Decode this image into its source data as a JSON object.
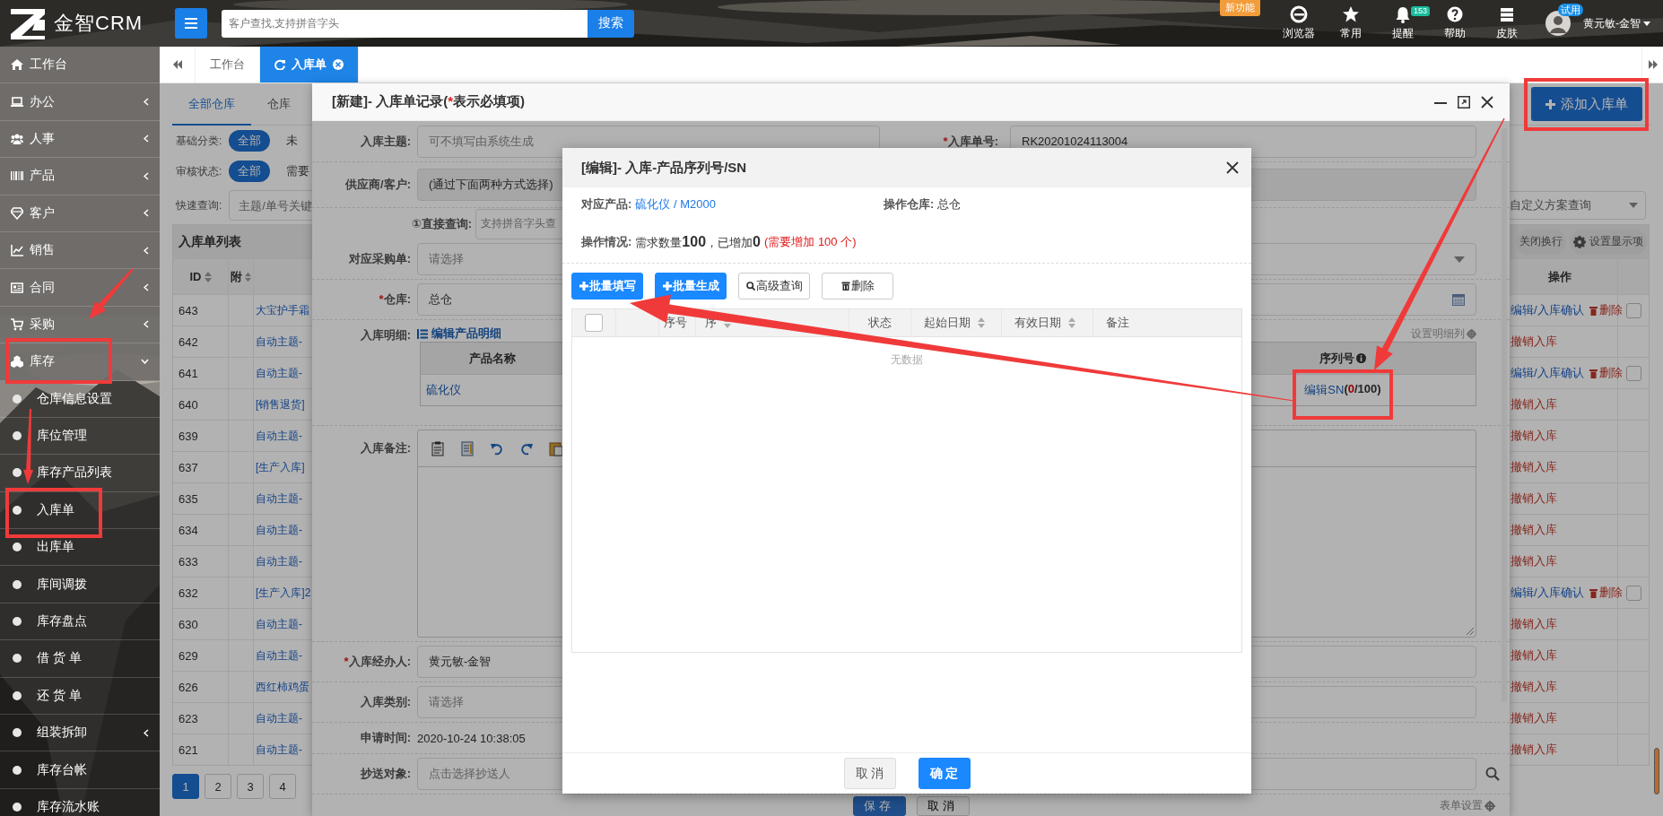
{
  "top_bar": {
    "brand": "金智CRM",
    "search": {
      "placeholder": "客户查找,支持拼音字头"
    },
    "search_button": "搜索",
    "new_badge": "新功能",
    "shortcuts": [
      {
        "label": "浏览器"
      },
      {
        "label": "常用"
      },
      {
        "label": "提醒",
        "badge": "153"
      },
      {
        "label": "帮助"
      },
      {
        "label": "皮肤"
      }
    ],
    "user": {
      "name": "黄元敏-金智",
      "badge": "试用"
    }
  },
  "sidebar": [
    {
      "label": "工作台",
      "kind": "link"
    },
    {
      "label": "办公",
      "kind": "group",
      "expanded": false
    },
    {
      "label": "人事",
      "kind": "group",
      "expanded": false
    },
    {
      "label": "产品",
      "kind": "group",
      "expanded": false
    },
    {
      "label": "客户",
      "kind": "group",
      "expanded": false
    },
    {
      "label": "销售",
      "kind": "group",
      "expanded": false
    },
    {
      "label": "合同",
      "kind": "group",
      "expanded": false
    },
    {
      "label": "采购",
      "kind": "group",
      "expanded": false
    },
    {
      "label": "库存",
      "kind": "group",
      "expanded": true,
      "children": [
        {
          "label": "仓库信息设置",
          "kind": "link"
        },
        {
          "label": "库位管理",
          "kind": "link"
        },
        {
          "label": "库存产品列表",
          "kind": "link"
        },
        {
          "label": "入库单",
          "kind": "link"
        },
        {
          "label": "出库单",
          "kind": "link"
        },
        {
          "label": "库间调拨",
          "kind": "link"
        },
        {
          "label": "库存盘点",
          "kind": "link"
        },
        {
          "label": "借 货 单",
          "kind": "link"
        },
        {
          "label": "还 货 单",
          "kind": "link"
        },
        {
          "label": "组装拆卸",
          "kind": "group",
          "expanded": false
        },
        {
          "label": "库存台帐",
          "kind": "link"
        },
        {
          "label": "库存流水账",
          "kind": "link"
        }
      ]
    }
  ],
  "tabs": [
    {
      "label": "工作台",
      "selected": false
    },
    {
      "label": "入库单",
      "selected": true
    }
  ],
  "page": {
    "subtabs": [
      {
        "label": "全部仓库",
        "selected": true
      },
      {
        "label": "仓库",
        "selected": false
      }
    ],
    "add_button": "添加入库单",
    "filters": [
      {
        "label": "基础分类:",
        "options": [
          {
            "label": "全部",
            "selected": true
          },
          {
            "label": "未",
            "selected": false
          }
        ]
      },
      {
        "label": "审核状态:",
        "options": [
          {
            "label": "全部",
            "selected": true
          },
          {
            "label": "需要",
            "selected": false
          }
        ]
      }
    ],
    "quick_search": {
      "label": "快速查询:",
      "placeholder": "主题/单号关键"
    },
    "scheme_select": {
      "placeholder": "自定义方案查询"
    },
    "table": {
      "title": "入库单列表",
      "tools": [
        "关闭换行",
        "设置显示项"
      ],
      "columns": [
        "ID",
        "附",
        "操作"
      ],
      "rows": [
        {
          "id": "643",
          "subject": "大宝护手霜",
          "kind": "pending",
          "actions": [
            "编辑/入库确认",
            "删除"
          ],
          "checked": false
        },
        {
          "id": "642",
          "subject": "自动主题-",
          "kind": "done",
          "actions": [
            "撤销入库"
          ]
        },
        {
          "id": "641",
          "subject": "自动主题-",
          "kind": "pending",
          "actions": [
            "编辑/入库确认",
            "删除"
          ],
          "checked": false
        },
        {
          "id": "640",
          "subject": "[销售退货]",
          "kind": "done",
          "actions": [
            "撤销入库"
          ]
        },
        {
          "id": "639",
          "subject": "自动主题-",
          "kind": "done",
          "actions": [
            "撤销入库"
          ]
        },
        {
          "id": "637",
          "subject": "[生产入库]",
          "kind": "done",
          "actions": [
            "撤销入库"
          ]
        },
        {
          "id": "635",
          "subject": "自动主题-",
          "kind": "done",
          "actions": [
            "撤销入库"
          ]
        },
        {
          "id": "634",
          "subject": "自动主题-",
          "kind": "done",
          "actions": [
            "撤销入库"
          ]
        },
        {
          "id": "633",
          "subject": "自动主题-",
          "kind": "done",
          "actions": [
            "撤销入库"
          ]
        },
        {
          "id": "632",
          "subject": "[生产入库]2",
          "kind": "pending",
          "actions": [
            "编辑/入库确认",
            "删除"
          ],
          "checked": false
        },
        {
          "id": "630",
          "subject": "自动主题-",
          "kind": "done",
          "actions": [
            "撤销入库"
          ]
        },
        {
          "id": "629",
          "subject": "自动主题-",
          "kind": "done",
          "actions": [
            "撤销入库"
          ]
        },
        {
          "id": "626",
          "subject": "西红柿鸡蛋",
          "kind": "done",
          "actions": [
            "撤销入库"
          ]
        },
        {
          "id": "623",
          "subject": "自动主题-",
          "kind": "done",
          "actions": [
            "撤销入库"
          ]
        },
        {
          "id": "621",
          "subject": "自动主题-",
          "kind": "done",
          "actions": [
            "撤销入库"
          ]
        }
      ]
    },
    "pages": [
      {
        "label": "1",
        "selected": true
      },
      {
        "label": "2",
        "selected": false
      },
      {
        "label": "3",
        "selected": false
      },
      {
        "label": "4",
        "selected": false
      }
    ]
  },
  "record_dialog": {
    "title": "[新建]- 入库单记录(",
    "title_mark": "*",
    "title_end": "表示必填项)",
    "rows": [
      {
        "kind": "pair",
        "label": "入库主题:",
        "placeholder": "可不填写由系统生成",
        "side_label": "入库单号:",
        "side_mark": "*",
        "side_value": "RK20201024113004"
      },
      {
        "kind": "disabled",
        "label": "供应商/客户:",
        "value": "(通过下面两种方式选择)"
      },
      {
        "kind": "lookup",
        "label": "①直接查询:",
        "placeholder": "支持拼音字头查"
      },
      {
        "kind": "select",
        "label": "对应采购单:",
        "placeholder": "请选择"
      },
      {
        "kind": "date",
        "label": "仓库:",
        "mark": "*",
        "value": "总仓"
      },
      {
        "kind": "detail",
        "label": "入库明细:",
        "link": "编辑产品明细",
        "settings": "设置明细列",
        "columns": [
          "产品名称",
          "序列号"
        ],
        "product": "硫化仪",
        "sn_link": "编辑SN",
        "sn_parts": [
          {
            "text": "(",
            "kind": "plain"
          },
          {
            "text": "0",
            "kind": "alert"
          },
          {
            "text": "/100)",
            "kind": "plain"
          }
        ]
      },
      {
        "kind": "editor",
        "label": "入库备注:"
      },
      {
        "kind": "input",
        "label": "入库经办人:",
        "mark": "*",
        "value": "黄元敏-金智"
      },
      {
        "kind": "input",
        "label": "入库类别:",
        "placeholder": "请选择"
      },
      {
        "kind": "plain",
        "label": "申请时间:",
        "value": "2020-10-24 10:38:05"
      },
      {
        "kind": "search",
        "label": "抄送对象:",
        "placeholder": "点击选择抄送人"
      }
    ],
    "buttons": [
      {
        "label": "保存",
        "kind": "primary"
      },
      {
        "label": "取消",
        "kind": "default"
      }
    ],
    "form_settings": "表单设置"
  },
  "sn_dialog": {
    "title": "[编辑]- 入库-产品序列号/SN",
    "product_label": "对应产品:",
    "product": "硫化仪 / M2000",
    "warehouse_label": "操作仓库:",
    "warehouse": "总仓",
    "status_label": "操作情况:",
    "status": "需求数量**100**，已增加**0**",
    "status_note": "(需要增加 100 个)",
    "buttons": [
      {
        "label": "批量填写",
        "kind": "add"
      },
      {
        "label": "批量生成",
        "kind": "add"
      },
      {
        "label": "高级查询",
        "kind": "search"
      },
      {
        "label": "删除",
        "kind": "delete"
      }
    ],
    "columns": [
      {
        "kind": "checkbox",
        "checked": false
      },
      {
        "kind": "blank"
      },
      {
        "kind": "text",
        "label": "序号",
        "sortable": false
      },
      {
        "kind": "text",
        "label": "序",
        "sortable": true
      },
      {
        "kind": "text",
        "label": "状态",
        "sortable": false
      },
      {
        "kind": "text",
        "label": "起始日期",
        "sortable": true
      },
      {
        "kind": "text",
        "label": "有效日期",
        "sortable": true
      },
      {
        "kind": "text",
        "label": "备注",
        "sortable": false
      }
    ],
    "empty_text": "无数据",
    "footer": [
      {
        "label": "取 消",
        "kind": "default"
      },
      {
        "label": "确 定",
        "kind": "primary"
      }
    ]
  }
}
